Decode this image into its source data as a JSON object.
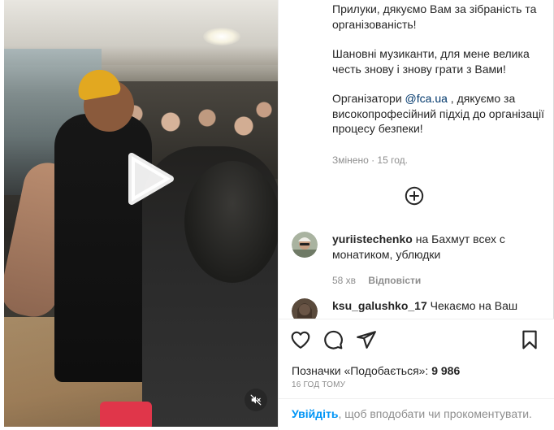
{
  "caption": {
    "para1": "Прилуки, дякуємо Вам за зібраність та організованість!",
    "para2": "Шановні музиканти, для мене велика честь знову і знову грати з Вами!",
    "para3_pre": "Організатори ",
    "para3_mention": "@fca.ua",
    "para3_post": " , дякуємо за високопрофесійний підхід до організації процесу безпеки!"
  },
  "edited": "Змінено · 15 год.",
  "add_icon": "plus-circle-icon",
  "comments": [
    {
      "user": "yuriistechenko",
      "text": " на Бахмут всех с монатиком, ублюдки",
      "time": "58 хв",
      "reply": "Відповісти"
    },
    {
      "user": "ksu_galushko_17",
      "text": " Чекаємо на Ваш"
    }
  ],
  "actions": {
    "like_icon": "heart-icon",
    "comment_icon": "comment-icon",
    "share_icon": "send-icon",
    "save_icon": "bookmark-icon"
  },
  "likes": {
    "label": "Позначки «Подобається»: ",
    "count": "9 986"
  },
  "timeago": "16 ГОД ТОМУ",
  "login": {
    "link": "Увійдіть",
    "rest": ", щоб вподобати чи прокоментувати."
  },
  "video": {
    "play_icon": "play-icon",
    "mute_icon": "muted-speaker-icon"
  },
  "colors": {
    "link": "#0095f6",
    "mention": "#00376b",
    "muted_text": "#8e8e8e",
    "text": "#262626",
    "beanie": "#e2a820"
  }
}
